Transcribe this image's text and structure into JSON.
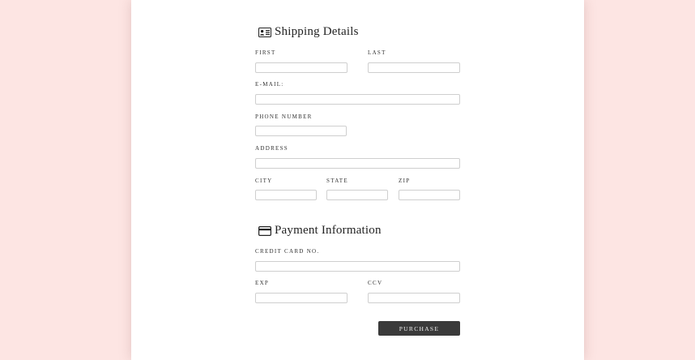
{
  "shipping": {
    "title": "Shipping Details",
    "icon": "id-card-icon",
    "fields": {
      "first": {
        "label": "FIRST",
        "value": ""
      },
      "last": {
        "label": "LAST",
        "value": ""
      },
      "email": {
        "label": "E-MAIL:",
        "value": ""
      },
      "phone": {
        "label": "PHONE NUMBER",
        "value": ""
      },
      "address": {
        "label": "ADDRESS",
        "value": ""
      },
      "city": {
        "label": "CITY",
        "value": ""
      },
      "state": {
        "label": "STATE",
        "value": ""
      },
      "zip": {
        "label": "ZIP",
        "value": ""
      }
    }
  },
  "payment": {
    "title": "Payment Information",
    "icon": "credit-card-icon",
    "fields": {
      "card": {
        "label": "CREDIT CARD NO.",
        "value": ""
      },
      "exp": {
        "label": "EXP",
        "value": ""
      },
      "ccv": {
        "label": "CCV",
        "value": ""
      }
    }
  },
  "actions": {
    "purchase_label": "PURCHASE"
  },
  "colors": {
    "page_background": "#fde5e3",
    "card_background": "#ffffff",
    "button_background": "#3a3a3a",
    "input_border": "#cfcfcf"
  }
}
